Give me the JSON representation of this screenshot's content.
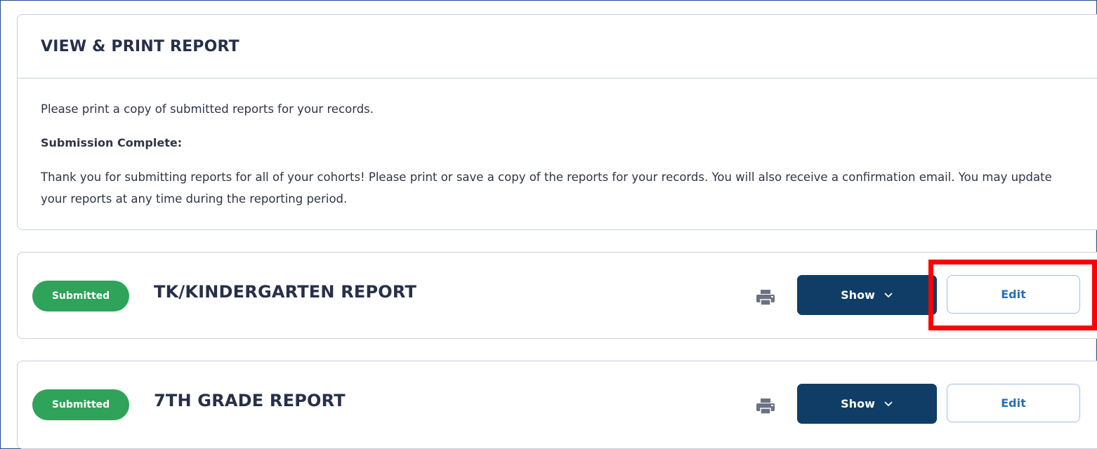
{
  "intro": {
    "title": "VIEW & PRINT REPORT",
    "line1": "Please print a copy of submitted reports for your records.",
    "subhead": "Submission Complete:",
    "thanks": "Thank you for submitting reports for all of your cohorts! Please print or save a copy of the reports for your records. You will also receive a confirmation email. You may update your reports at any time during the reporting period."
  },
  "reports": [
    {
      "status": "Submitted",
      "title": "TK/KINDERGARTEN REPORT",
      "show_label": "Show",
      "edit_label": "Edit"
    },
    {
      "status": "Submitted",
      "title": "7TH GRADE REPORT",
      "show_label": "Show",
      "edit_label": "Edit"
    }
  ],
  "colors": {
    "badge": "#2fa35a",
    "show_button": "#0f3d66",
    "edit_text": "#2a6fb5",
    "highlight": "#ff0000"
  },
  "icons": {
    "print": "printer-icon",
    "chevron": "chevron-down-icon"
  }
}
